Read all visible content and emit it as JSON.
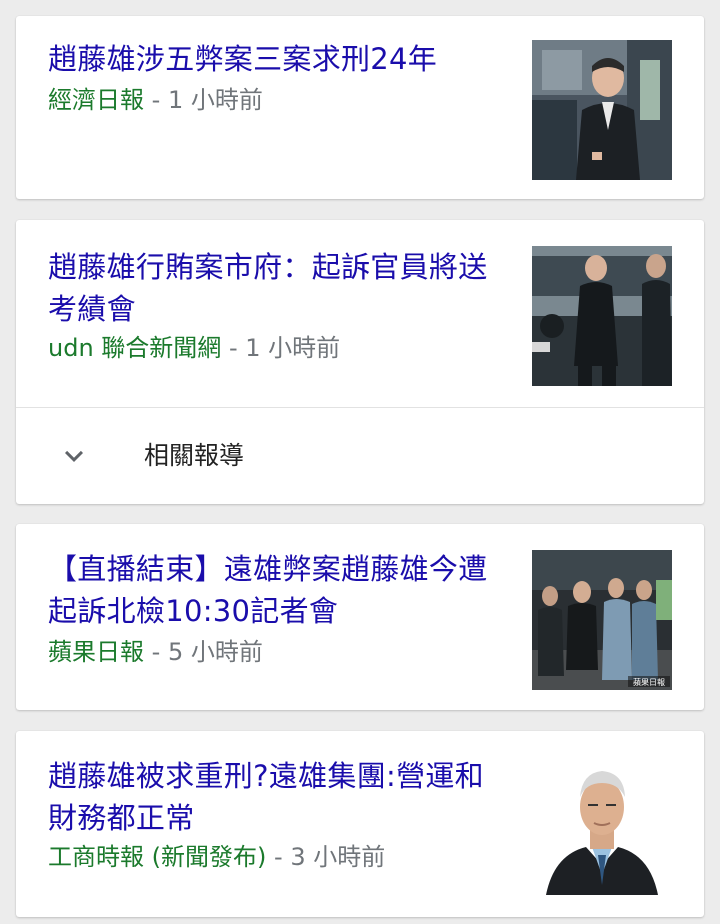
{
  "articles": [
    {
      "title": "趙藤雄涉五弊案三案求刑24年",
      "source": "經濟日報",
      "separator": "-",
      "time": "1 小時前",
      "thumbnail": "photo-man-suit-bus"
    },
    {
      "title": "趙藤雄行賄案市府：起訴官員將送考績會",
      "source": "udn 聯合新聞網",
      "separator": "-",
      "time": "1 小時前",
      "thumbnail": "photo-men-walking-bus",
      "related_label": "相關報導"
    },
    {
      "title": "【直播結束】遠雄弊案趙藤雄今遭起訴北檢10:30記者會",
      "source": "蘋果日報",
      "separator": "-",
      "time": "5 小時前",
      "thumbnail": "photo-group-escort",
      "thumbnail_watermark": "蘋果日報"
    },
    {
      "title": "趙藤雄被求重刑?遠雄集團:營運和財務都正常",
      "source": "工商時報 (新聞發布)",
      "separator": "-",
      "time": "3 小時前",
      "thumbnail": "photo-portrait-man"
    }
  ],
  "colors": {
    "title": "#1a0dab",
    "source": "#1b7a2c",
    "time": "#70757a",
    "background": "#ececec",
    "card": "#ffffff"
  },
  "icons": {
    "expand": "chevron-down-icon"
  }
}
